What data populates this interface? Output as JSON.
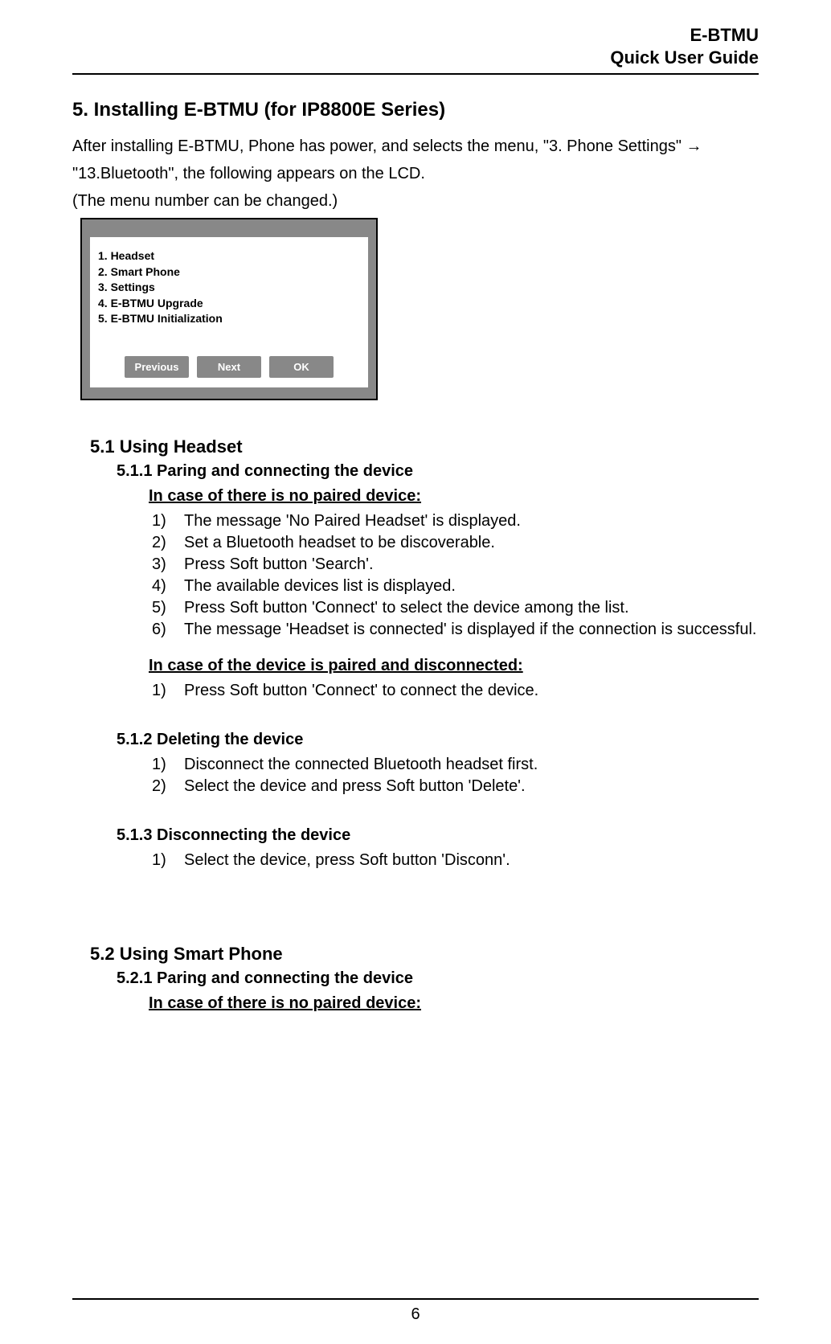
{
  "header": {
    "line1": "E-BTMU",
    "line2": "Quick User Guide"
  },
  "section": {
    "title": "5.  Installing E-BTMU (for IP8800E Series)",
    "intro1": "After installing E-BTMU, Phone has power, and selects the menu, \"3. Phone Settings\" →",
    "intro2": "\"13.Bluetooth\", the following appears on the LCD.",
    "intro3": "(The menu number can be changed.)"
  },
  "lcd": {
    "items": [
      "1.  Headset",
      "2.  Smart Phone",
      "3.  Settings",
      "4.  E-BTMU Upgrade",
      "5.  E-BTMU Initialization"
    ],
    "buttons": {
      "prev": "Previous",
      "next": "Next",
      "ok": "OK"
    }
  },
  "s51": {
    "title": "5.1   Using Headset",
    "s511": {
      "title": "5.1.1 Paring and connecting the device",
      "caseA": {
        "heading": "In case of there is no paired device:",
        "steps": [
          "The message 'No Paired Headset' is displayed.",
          "Set a Bluetooth headset to be discoverable.",
          "Press Soft button 'Search'.",
          "The available devices list is displayed.",
          "Press Soft button 'Connect' to select the device among the list.",
          "The message 'Headset is connected' is displayed if the connection is successful."
        ]
      },
      "caseB": {
        "heading": "In case of the device is paired and disconnected:",
        "steps": [
          "Press Soft button 'Connect' to connect the device."
        ]
      }
    },
    "s512": {
      "title": "5.1.2 Deleting the device",
      "steps": [
        "Disconnect the connected Bluetooth headset first.",
        "Select the device and press Soft button 'Delete'."
      ]
    },
    "s513": {
      "title": "5.1.3 Disconnecting the device",
      "steps": [
        "Select the device, press Soft button 'Disconn'."
      ]
    }
  },
  "s52": {
    "title": "5.2   Using Smart Phone",
    "s521": {
      "title": "5.2.1 Paring and connecting the device",
      "caseA": {
        "heading": "In case of there is no paired device:"
      }
    }
  },
  "pageNumber": "6"
}
